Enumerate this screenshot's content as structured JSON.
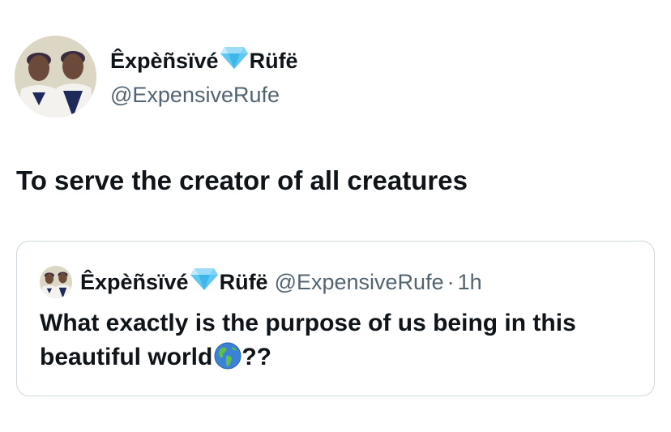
{
  "tweet": {
    "author": {
      "name_part1": "Êxpèñsïvé",
      "name_part2": "Rüfë",
      "handle": "@ExpensiveRufe",
      "avatar_icon": "profile-photo-two-boys"
    },
    "text": "To serve the creator of all creatures",
    "quoted": {
      "name_part1": "Êxpèñsïvé",
      "name_part2": "Rüfë",
      "handle": "@ExpensiveRufe",
      "separator": "·",
      "time": "1h",
      "text_main": "What exactly is the purpose of us being in this beautiful world",
      "text_end": "??",
      "emoji_icon": "globe-americas-icon"
    }
  },
  "colors": {
    "text_primary": "#0f1419",
    "text_secondary": "#536471",
    "border": "#cfd9de",
    "gem": "#5ec8f2"
  }
}
